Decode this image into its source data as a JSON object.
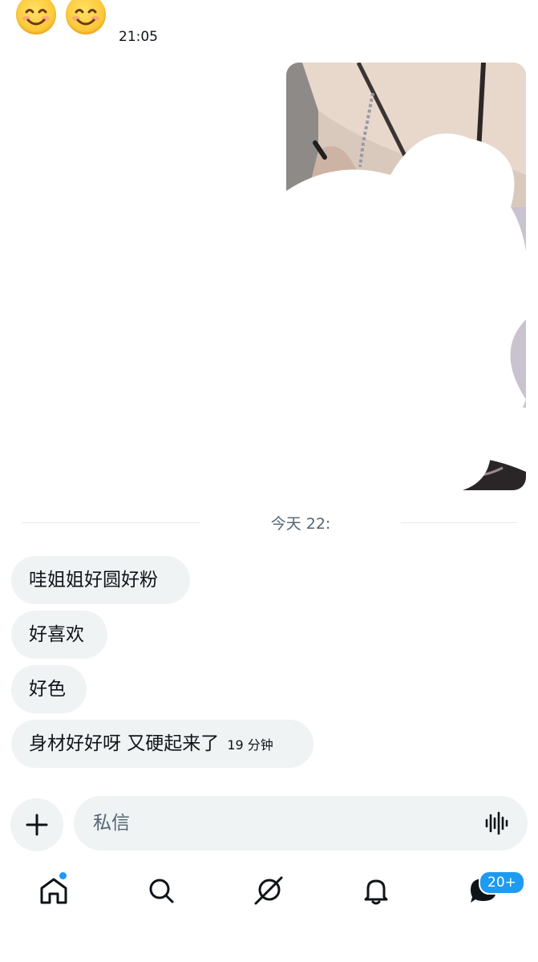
{
  "top": {
    "emojis": [
      "smiling-face-icon",
      "smiling-face-icon"
    ],
    "timestamp": "21:05"
  },
  "divider": {
    "label": "今天 22:"
  },
  "messages": [
    {
      "text": "哇姐姐好圆好粉"
    },
    {
      "text": "好喜欢"
    },
    {
      "text": "好色"
    },
    {
      "text": "身材好好呀 又硬起来了",
      "meta": "19 分钟"
    }
  ],
  "composer": {
    "placeholder": "私信"
  },
  "nav": {
    "items": [
      "home-icon",
      "search-icon",
      "grok-icon",
      "notifications-icon",
      "messages-icon"
    ],
    "messages_badge": "20+"
  },
  "colors": {
    "accent": "#1d9bf0",
    "bubble": "#eff3f4",
    "muted": "#536471"
  }
}
